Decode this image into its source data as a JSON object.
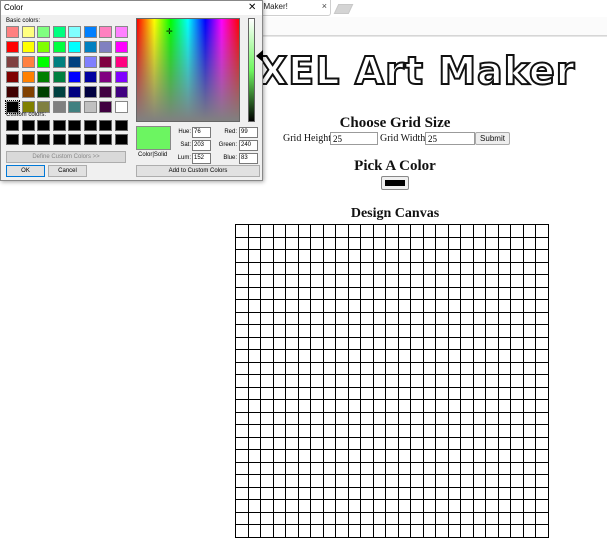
{
  "browser": {
    "tab_title": "t Maker!",
    "tab_close": "×"
  },
  "page": {
    "logo_text": "XEL Art Maker",
    "heading_grid": "Choose Grid Size",
    "grid_height_label": "Grid Height:",
    "grid_height_value": "25",
    "grid_width_label": "Grid Width:",
    "grid_width_value": "25",
    "submit_label": "Submit",
    "heading_pick": "Pick A Color",
    "picked_color": "#000000",
    "heading_design": "Design Canvas"
  },
  "dialog": {
    "title": "Color",
    "close": "✕",
    "basic_colors_label": "Basic colors:",
    "custom_colors_label": "Custom colors:",
    "basic_colors": [
      "#ff8080",
      "#ffff80",
      "#80ff80",
      "#00ff80",
      "#80ffff",
      "#0080ff",
      "#ff80c0",
      "#ff80ff",
      "#ff0000",
      "#ffff00",
      "#80ff00",
      "#00ff40",
      "#00ffff",
      "#0080c0",
      "#8080c0",
      "#ff00ff",
      "#804040",
      "#ff8040",
      "#00ff00",
      "#008080",
      "#004080",
      "#8080ff",
      "#800040",
      "#ff0080",
      "#800000",
      "#ff8000",
      "#008000",
      "#008040",
      "#0000ff",
      "#0000a0",
      "#800080",
      "#8000ff",
      "#400000",
      "#804000",
      "#004000",
      "#004040",
      "#000080",
      "#000040",
      "#400040",
      "#400080",
      "#000000",
      "#808000",
      "#808040",
      "#808080",
      "#408080",
      "#c0c0c0",
      "#400040",
      "#ffffff"
    ],
    "custom_colors": [
      "#000000",
      "#000000",
      "#000000",
      "#000000",
      "#000000",
      "#000000",
      "#000000",
      "#000000",
      "#000000",
      "#000000",
      "#000000",
      "#000000",
      "#000000",
      "#000000",
      "#000000",
      "#000000"
    ],
    "define_btn": "Define Custom Colors >>",
    "ok_btn": "OK",
    "cancel_btn": "Cancel",
    "add_btn": "Add to Custom Colors",
    "preview_label": "Color|Solid",
    "preview_color": "#6cf561",
    "hue_label": "Hue:",
    "hue_value": "76",
    "sat_label": "Sat:",
    "sat_value": "203",
    "lum_label": "Lum:",
    "lum_value": "152",
    "red_label": "Red:",
    "red_value": "99",
    "green_label": "Green:",
    "green_value": "240",
    "blue_label": "Blue:",
    "blue_value": "83"
  }
}
